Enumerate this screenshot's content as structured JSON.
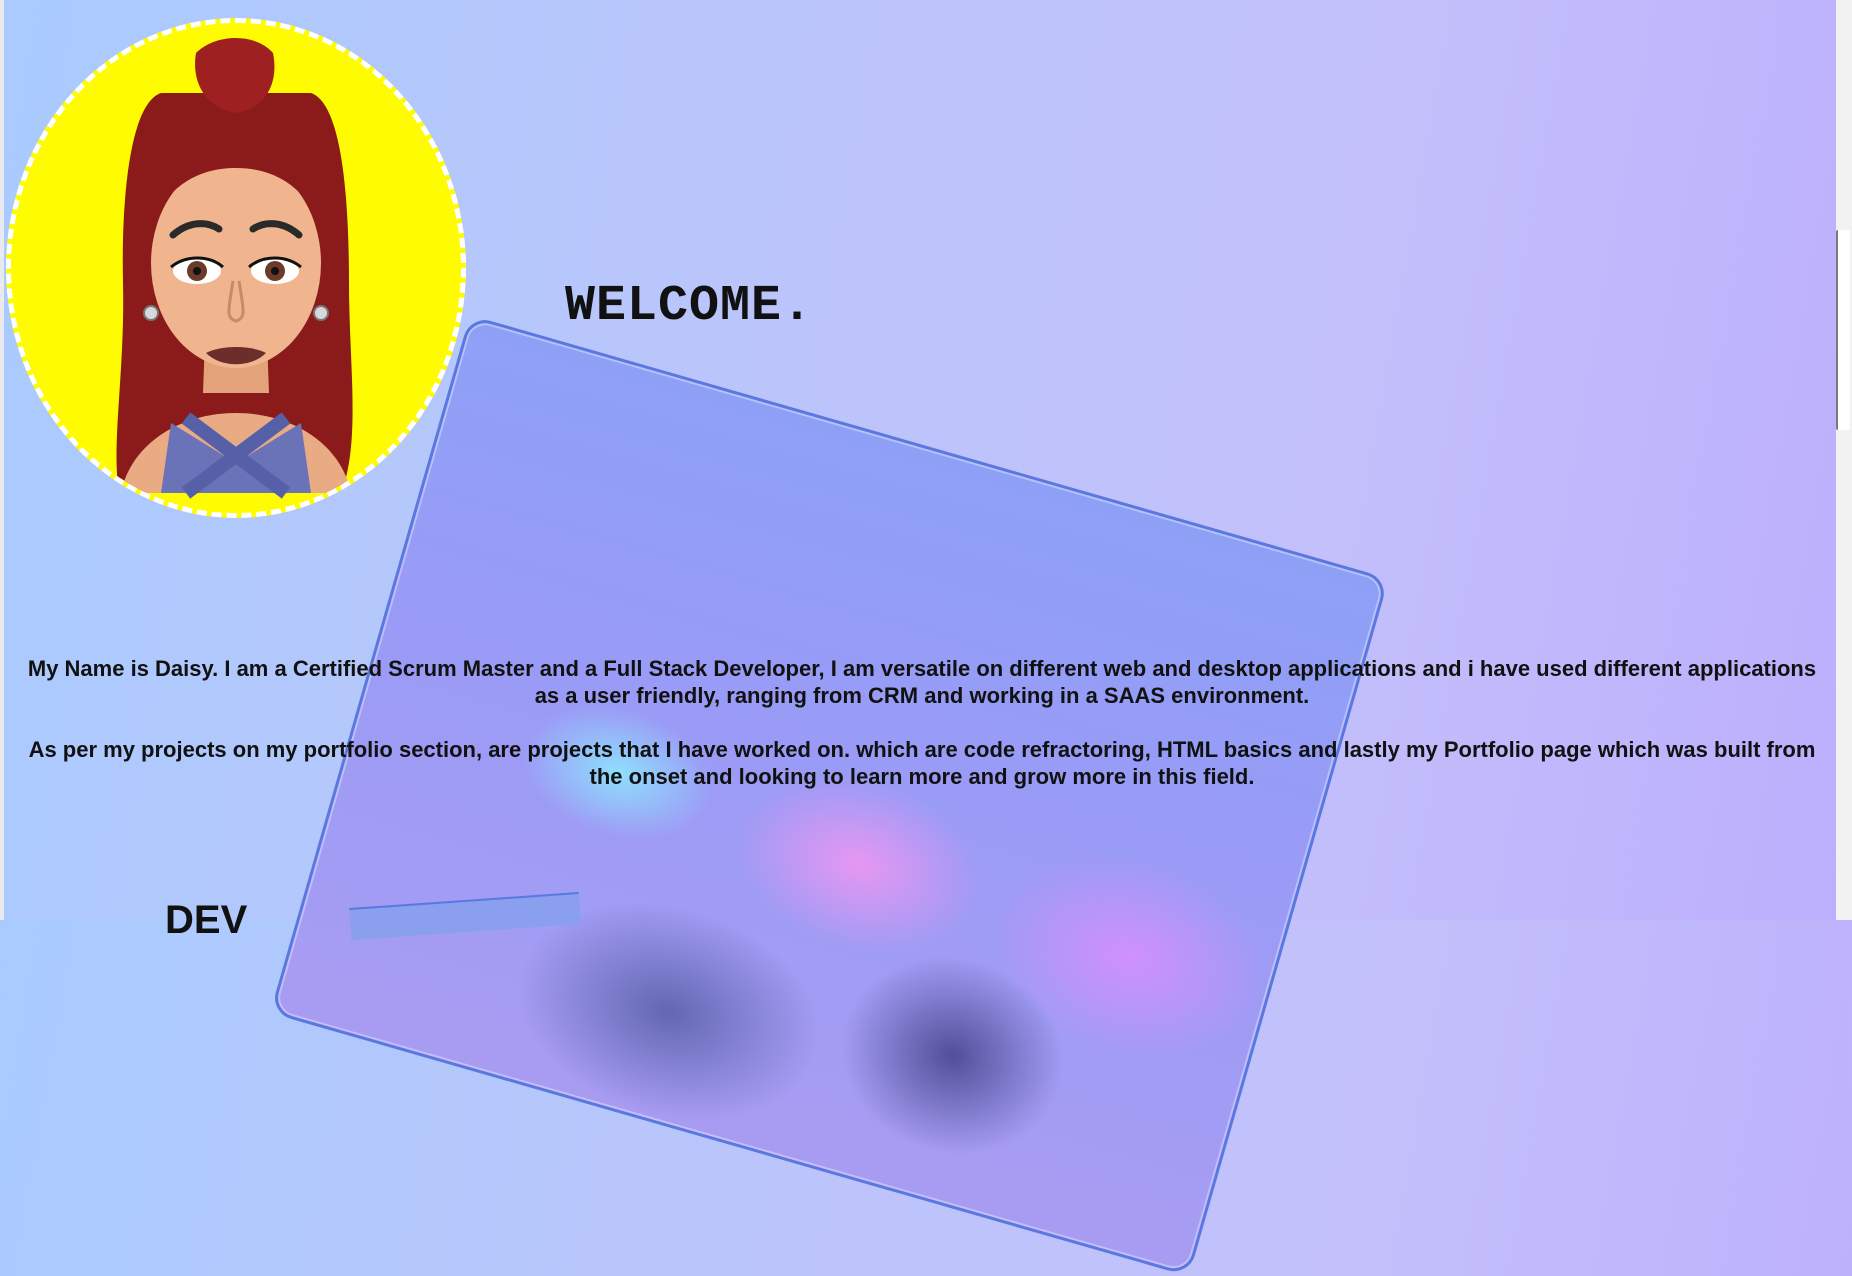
{
  "hero": {
    "welcome": "WELCOME."
  },
  "about": {
    "paragraph1": "My Name is Daisy.   I am a Certified Scrum Master and a Full Stack Developer, I am versatile on different web and desktop applications and i have used different applications as a user friendly, ranging from CRM and working in a SAAS environment.",
    "paragraph2": "As per my projects on my portfolio section, are projects that I have worked on. which are code refractoring, HTML basics and lastly my Portfolio page which was built from the onset and looking to learn more and grow more in this field."
  },
  "next_section": {
    "heading": "DEV"
  },
  "colors": {
    "avatar_background": "#fffb00",
    "hair": "#8b1a1a",
    "laptop_border": "#5a78e0"
  }
}
